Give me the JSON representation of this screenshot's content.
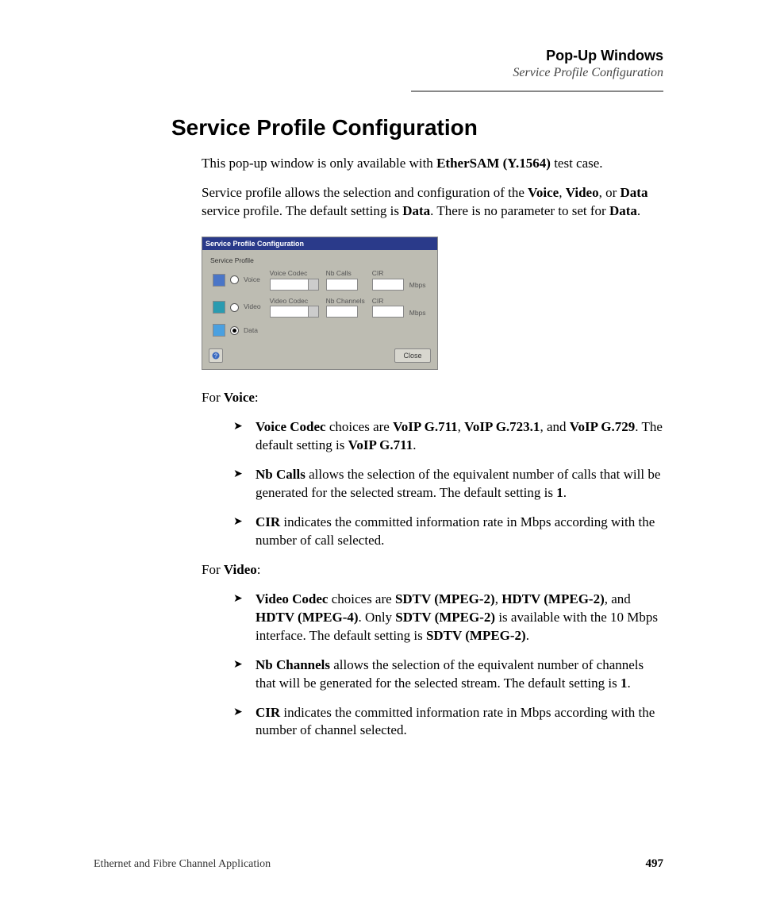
{
  "header": {
    "line1": "Pop-Up Windows",
    "line2": "Service Profile Configuration"
  },
  "heading": "Service Profile Configuration",
  "intro": {
    "p1_a": "This pop-up window is only available with ",
    "p1_b": "EtherSAM (Y.1564)",
    "p1_c": " test case.",
    "p2_a": "Service profile allows the selection and configuration of the ",
    "p2_b": "Voice",
    "p2_c": ", ",
    "p2_d": "Video",
    "p2_e": ", or ",
    "p2_f": "Data",
    "p2_g": " service profile. The default setting is ",
    "p2_h": "Data",
    "p2_i": ". There is no parameter to set for ",
    "p2_j": "Data",
    "p2_k": "."
  },
  "dialog": {
    "title": "Service Profile Configuration",
    "group_label": "Service Profile",
    "rows": {
      "voice": {
        "label": "Voice",
        "col1": "Voice Codec",
        "col2": "Nb Calls",
        "col3": "CIR",
        "unit": "Mbps",
        "selected": false
      },
      "video": {
        "label": "Video",
        "col1": "Video Codec",
        "col2": "Nb Channels",
        "col3": "CIR",
        "unit": "Mbps",
        "selected": false
      },
      "data": {
        "label": "Data",
        "selected": true
      }
    },
    "close_btn": "Close"
  },
  "voice_section": {
    "lead_a": "For ",
    "lead_b": "Voice",
    "lead_c": ":",
    "b1_a": "Voice Codec",
    "b1_b": " choices are ",
    "b1_c": "VoIP G.711",
    "b1_d": ", ",
    "b1_e": "VoIP G.723.1",
    "b1_f": ", and ",
    "b1_g": "VoIP G.729",
    "b1_h": ". The default setting is ",
    "b1_i": "VoIP G.711",
    "b1_j": ".",
    "b2_a": "Nb Calls",
    "b2_b": " allows the selection of the equivalent number of calls that will be generated for the selected stream. The default setting is ",
    "b2_c": "1",
    "b2_d": ".",
    "b3_a": "CIR",
    "b3_b": " indicates the committed information rate in Mbps according with the number of call selected."
  },
  "video_section": {
    "lead_a": "For ",
    "lead_b": "Video",
    "lead_c": ":",
    "b1_a": "Video Codec",
    "b1_b": " choices are ",
    "b1_c": "SDTV (MPEG-2)",
    "b1_d": ", ",
    "b1_e": "HDTV (MPEG-2)",
    "b1_f": ", and ",
    "b1_g": "HDTV (MPEG-4)",
    "b1_h": ". Only ",
    "b1_i": "SDTV (MPEG-2)",
    "b1_j": " is available with the 10 Mbps interface. The default setting is ",
    "b1_k": "SDTV (MPEG-2)",
    "b1_l": ".",
    "b2_a": "Nb Channels",
    "b2_b": " allows the selection of the equivalent number of channels that will be generated for the selected stream. The default setting is ",
    "b2_c": "1",
    "b2_d": ".",
    "b3_a": "CIR",
    "b3_b": " indicates the committed information rate in Mbps according with the number of channel selected."
  },
  "footer": {
    "left": "Ethernet and Fibre Channel Application",
    "right": "497"
  }
}
